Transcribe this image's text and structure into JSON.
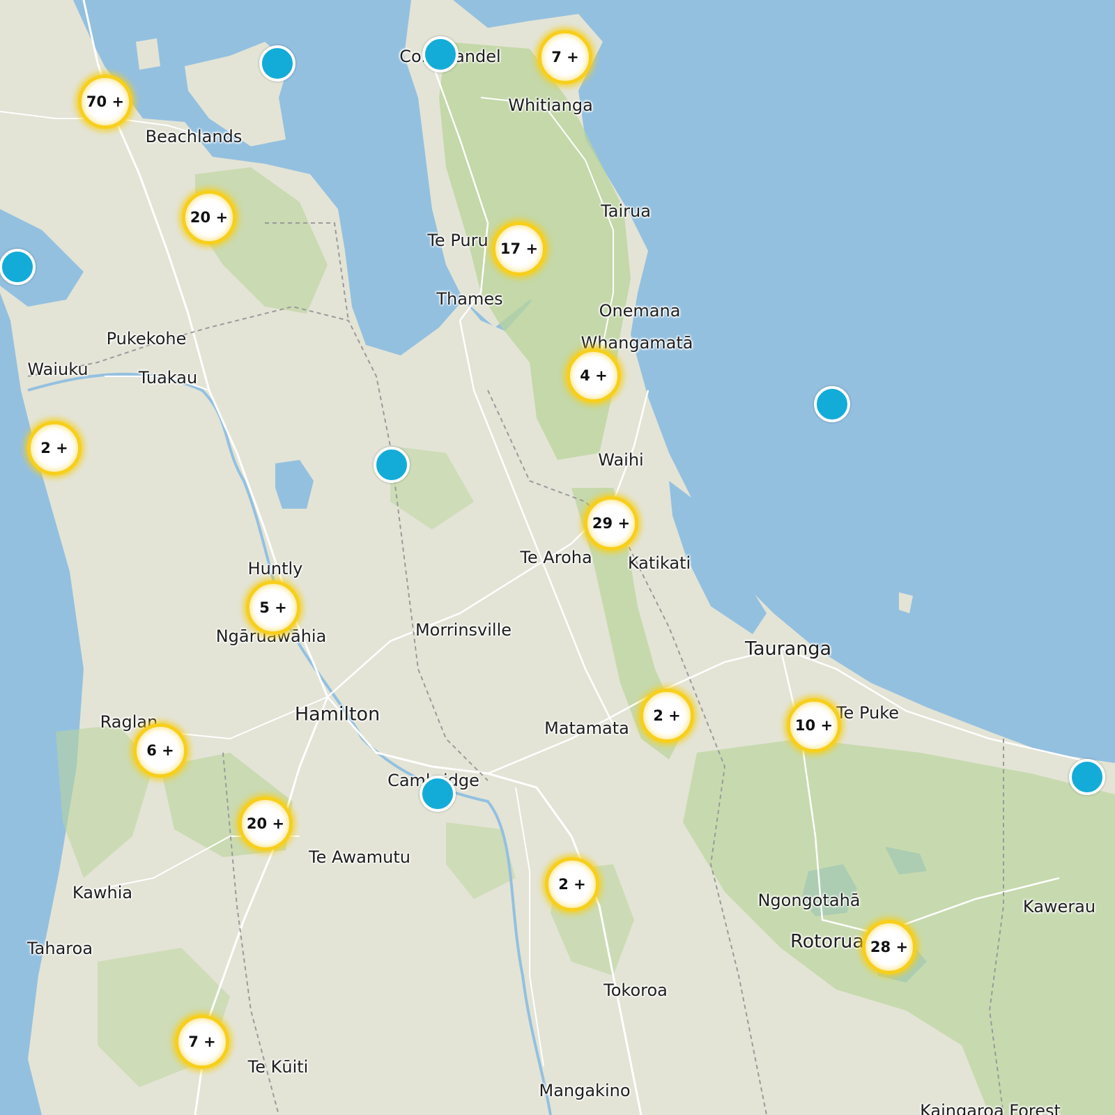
{
  "map": {
    "colors": {
      "water": "#94c0e0",
      "land": "#e3e4d6",
      "forest": "#b9d49a",
      "road": "#ffffff",
      "boundary": "#9a9a9a",
      "cluster_ring": "#f7cf1c",
      "pin": "#13acd8"
    },
    "places": [
      {
        "id": "coromandel",
        "label": "Coromandel"
      },
      {
        "id": "whitianga",
        "label": "Whitianga"
      },
      {
        "id": "beachlands",
        "label": "Beachlands"
      },
      {
        "id": "tairua",
        "label": "Tairua"
      },
      {
        "id": "te-puru",
        "label": "Te Puru"
      },
      {
        "id": "thames",
        "label": "Thames"
      },
      {
        "id": "onemana",
        "label": "Onemana"
      },
      {
        "id": "whangamata",
        "label": "Whangamatā"
      },
      {
        "id": "pukekohe",
        "label": "Pukekohe"
      },
      {
        "id": "waiuku",
        "label": "Waiuku"
      },
      {
        "id": "tuakau",
        "label": "Tuakau"
      },
      {
        "id": "waihi",
        "label": "Waihi"
      },
      {
        "id": "te-aroha",
        "label": "Te Aroha"
      },
      {
        "id": "katikati",
        "label": "Katikati"
      },
      {
        "id": "huntly",
        "label": "Huntly"
      },
      {
        "id": "ngaruawahia",
        "label": "Ngāruawāhia"
      },
      {
        "id": "morrinsville",
        "label": "Morrinsville"
      },
      {
        "id": "tauranga",
        "label": "Tauranga"
      },
      {
        "id": "raglan",
        "label": "Raglan"
      },
      {
        "id": "hamilton",
        "label": "Hamilton"
      },
      {
        "id": "matamata",
        "label": "Matamata"
      },
      {
        "id": "te-puke",
        "label": "Te Puke"
      },
      {
        "id": "cambridge",
        "label": "Cambridge"
      },
      {
        "id": "te-awamutu",
        "label": "Te Awamutu"
      },
      {
        "id": "kawhia",
        "label": "Kawhia"
      },
      {
        "id": "ngongotaha",
        "label": "Ngongotahā"
      },
      {
        "id": "kawerau",
        "label": "Kawerau"
      },
      {
        "id": "rotorua",
        "label": "Rotorua"
      },
      {
        "id": "taharoa",
        "label": "Taharoa"
      },
      {
        "id": "tokoroa",
        "label": "Tokoroa"
      },
      {
        "id": "te-kuiti",
        "label": "Te Kūiti"
      },
      {
        "id": "mangakino",
        "label": "Mangakino"
      },
      {
        "id": "kaingaroa-forest",
        "label": "Kaingaroa Forest"
      }
    ],
    "clusters": [
      {
        "id": "whitianga",
        "label": "7 +"
      },
      {
        "id": "auckland",
        "label": "70 +"
      },
      {
        "id": "hunua",
        "label": "20 +"
      },
      {
        "id": "te-puru",
        "label": "17 +"
      },
      {
        "id": "whangamata",
        "label": "4 +"
      },
      {
        "id": "port-waikato",
        "label": "2 +"
      },
      {
        "id": "waihi",
        "label": "29 +"
      },
      {
        "id": "huntly",
        "label": "5 +"
      },
      {
        "id": "kaimai",
        "label": "2 +"
      },
      {
        "id": "te-puke",
        "label": "10 +"
      },
      {
        "id": "raglan",
        "label": "6 +"
      },
      {
        "id": "pirongia",
        "label": "20 +"
      },
      {
        "id": "putaruru",
        "label": "2 +"
      },
      {
        "id": "rotorua",
        "label": "28 +"
      },
      {
        "id": "te-kuiti",
        "label": "7 +"
      }
    ],
    "pins": [
      {
        "id": "waiheke"
      },
      {
        "id": "coromandel"
      },
      {
        "id": "awhitu"
      },
      {
        "id": "slipper-island"
      },
      {
        "id": "hauraki"
      },
      {
        "id": "cambridge"
      },
      {
        "id": "matata"
      }
    ]
  }
}
